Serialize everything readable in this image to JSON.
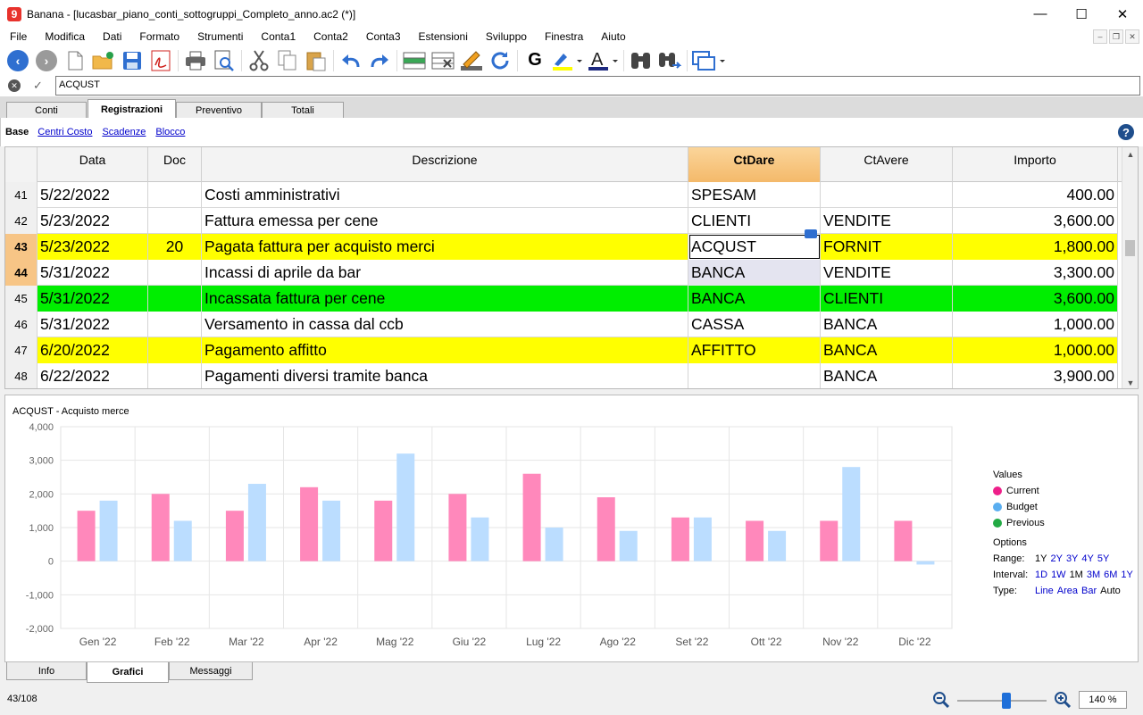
{
  "window": {
    "title": "Banana - [lucasbar_piano_conti_sottogruppi_Completo_anno.ac2 (*)]",
    "logo_text": "9"
  },
  "menu": [
    "File",
    "Modifica",
    "Dati",
    "Formato",
    "Strumenti",
    "Conta1",
    "Conta2",
    "Conta3",
    "Estensioni",
    "Sviluppo",
    "Finestra",
    "Aiuto"
  ],
  "formula_bar": {
    "value": "ACQUST"
  },
  "table_tabs": [
    "Conti",
    "Registrazioni",
    "Preventivo",
    "Totali"
  ],
  "active_table_tab": "Registrazioni",
  "views": [
    "Base",
    "Centri Costo",
    "Scadenze",
    "Blocco"
  ],
  "columns": [
    "Data",
    "Doc",
    "Descrizione",
    "CtDare",
    "CtAvere",
    "Importo"
  ],
  "rows": [
    {
      "n": "41",
      "data": "5/22/2022",
      "doc": "",
      "desc": "Costi amministrativi",
      "dare": "SPESAM",
      "avere": "",
      "importo": "400.00",
      "style": ""
    },
    {
      "n": "42",
      "data": "5/23/2022",
      "doc": "",
      "desc": "Fattura emessa per cene",
      "dare": "CLIENTI",
      "avere": "VENDITE",
      "importo": "3,600.00",
      "style": ""
    },
    {
      "n": "43",
      "data": "5/23/2022",
      "doc": "20",
      "desc": "Pagata fattura per acquisto merci",
      "dare": "ACQUST",
      "avere": "FORNIT",
      "importo": "1,800.00",
      "style": "yellow"
    },
    {
      "n": "44",
      "data": "5/31/2022",
      "doc": "",
      "desc": "Incassi di aprile da bar",
      "dare": "BANCA",
      "avere": "VENDITE",
      "importo": "3,300.00",
      "style": ""
    },
    {
      "n": "45",
      "data": "5/31/2022",
      "doc": "",
      "desc": "Incassata fattura per cene",
      "dare": "BANCA",
      "avere": "CLIENTI",
      "importo": "3,600.00",
      "style": "green"
    },
    {
      "n": "46",
      "data": "5/31/2022",
      "doc": "",
      "desc": "Versamento in cassa dal ccb",
      "dare": "CASSA",
      "avere": "BANCA",
      "importo": "1,000.00",
      "style": ""
    },
    {
      "n": "47",
      "data": "6/20/2022",
      "doc": "",
      "desc": "Pagamento affitto",
      "dare": "AFFITTO",
      "avere": "BANCA",
      "importo": "1,000.00",
      "style": "yellow"
    },
    {
      "n": "48",
      "data": "6/22/2022",
      "doc": "",
      "desc": "Pagamenti diversi tramite banca",
      "dare": "",
      "avere": "BANCA",
      "importo": "3,900.00",
      "style": ""
    }
  ],
  "chart_data": {
    "type": "bar",
    "title": "ACQUST - Acquisto merce",
    "categories": [
      "Gen '22",
      "Feb '22",
      "Mar '22",
      "Apr '22",
      "Mag '22",
      "Giu '22",
      "Lug '22",
      "Ago '22",
      "Set '22",
      "Ott '22",
      "Nov '22",
      "Dic '22"
    ],
    "series": [
      {
        "name": "Current",
        "color": "#ff88bb",
        "values": [
          1500,
          2000,
          1500,
          2200,
          1800,
          2000,
          2600,
          1900,
          1300,
          1200,
          1200,
          1200
        ]
      },
      {
        "name": "Budget",
        "color": "#bbddff",
        "values": [
          1800,
          1200,
          2300,
          1800,
          3200,
          1300,
          1000,
          900,
          1300,
          900,
          2800,
          -100
        ]
      }
    ],
    "ylim": [
      -2000,
      4000
    ],
    "yticks": [
      "4,000",
      "3,000",
      "2,000",
      "1,000",
      "0",
      "-1,000",
      "-2,000"
    ],
    "grid": true,
    "legend_placement": "right"
  },
  "legend": {
    "heading": "Values",
    "items": [
      {
        "label": "Current",
        "color": "#ee1f8a"
      },
      {
        "label": "Budget",
        "color": "#5aaef0"
      },
      {
        "label": "Previous",
        "color": "#22aa44"
      }
    ],
    "options_heading": "Options",
    "range_label": "Range:",
    "range": [
      "1Y",
      "2Y",
      "3Y",
      "4Y",
      "5Y"
    ],
    "range_selected": "1Y",
    "interval_label": "Interval:",
    "interval": [
      "1D",
      "1W",
      "1M",
      "3M",
      "6M",
      "1Y"
    ],
    "interval_selected": "1M",
    "type_label": "Type:",
    "type": [
      "Line",
      "Area",
      "Bar",
      "Auto"
    ],
    "type_selected": "Auto"
  },
  "bottom_tabs": [
    "Info",
    "Grafici",
    "Messaggi"
  ],
  "active_bottom_tab": "Grafici",
  "status": {
    "position": "43/108",
    "zoom": "140 %"
  }
}
